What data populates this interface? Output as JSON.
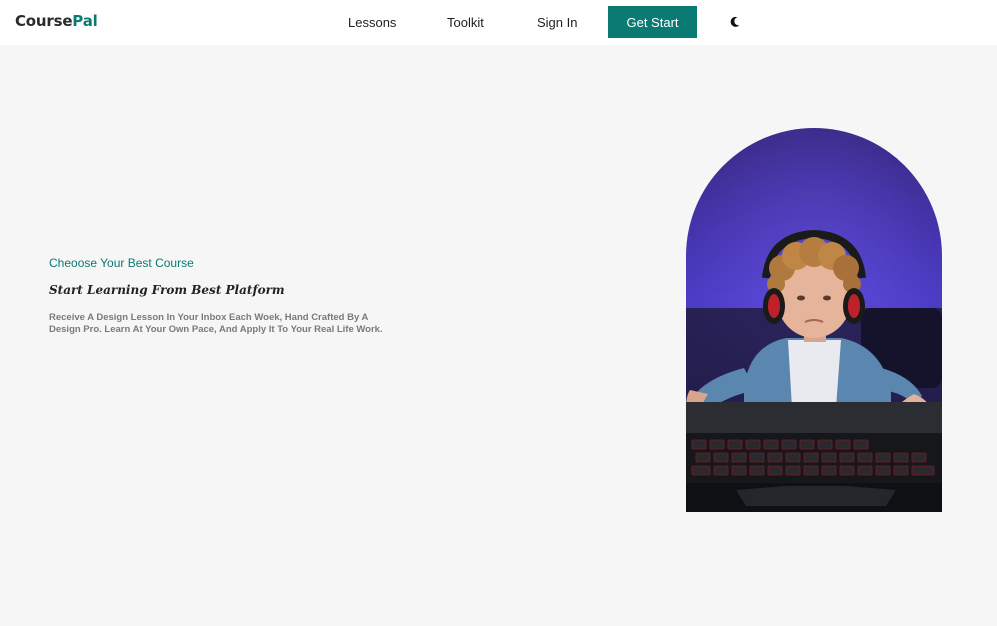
{
  "brand": {
    "name_part1": "Course",
    "name_part2": "Pal"
  },
  "nav": {
    "links": [
      "Lessons",
      "Toolkit",
      "Sign In"
    ],
    "cta_label": "Get Start",
    "theme_icon": "moon-icon"
  },
  "hero": {
    "eyebrow": "Cheoose Your Best Course",
    "title": "Start Learning From Best Platform",
    "description": "Receive A Design Lesson In Your Inbox Each Woek, Hand Crafted By A Design Pro. Learn At Your Own Pace, And Apply It To Your Real Life Work.",
    "image_subject": "boy-with-headphones-at-keyboard"
  },
  "colors": {
    "accent": "#0b7a72",
    "page_background": "#f6f6f6",
    "navbar_background": "#ffffff"
  }
}
